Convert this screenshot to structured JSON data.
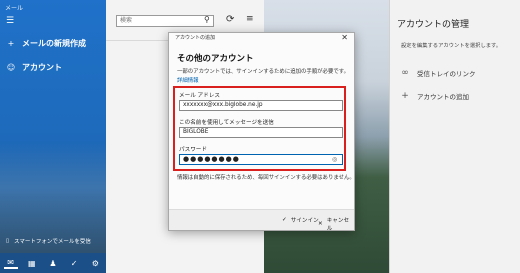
{
  "app": {
    "title": "メール"
  },
  "nav": {
    "new_mail": "メールの新規作成",
    "account": "アカウント",
    "phone_link": "スマートフォンでメールを受信"
  },
  "list": {
    "search_placeholder": "検索"
  },
  "manage": {
    "title": "アカウントの管理",
    "subtitle": "設定を編集するアカウントを選択します。",
    "link_inboxes": "受信トレイのリンク",
    "add_account": "アカウントの追加"
  },
  "dialog": {
    "header": "アカウントの追加",
    "title": "その他のアカウント",
    "description": "一部のアカウントでは、サインインするために追加の手順が必要です。",
    "details_link": "詳細情報",
    "email_label": "メール アドレス",
    "email_value": "xxxxxxx@xxx.biglobe.ne.jp",
    "name_label": "この名前を使用してメッセージを送信",
    "name_value": "BIGLOBE",
    "password_label": "パスワード",
    "password_value": "●●●●●●●●",
    "saved_note": "情報は自動的に保存されるため、毎回サインインする必要はありません。",
    "signin_label": "サインイン",
    "cancel_label": "キャンセル"
  },
  "colors": {
    "nav_blue": "#1f71c9",
    "accent": "#0063b1",
    "highlight_red": "#d9201f"
  },
  "icons": [
    "hamburger-icon",
    "plus-icon",
    "person-icon",
    "phone-icon",
    "mail-icon",
    "calendar-icon",
    "people-icon",
    "checkmark-icon",
    "gear-icon",
    "search-icon",
    "sync-icon",
    "filter-icon",
    "link-icon",
    "close-icon",
    "eye-icon"
  ]
}
